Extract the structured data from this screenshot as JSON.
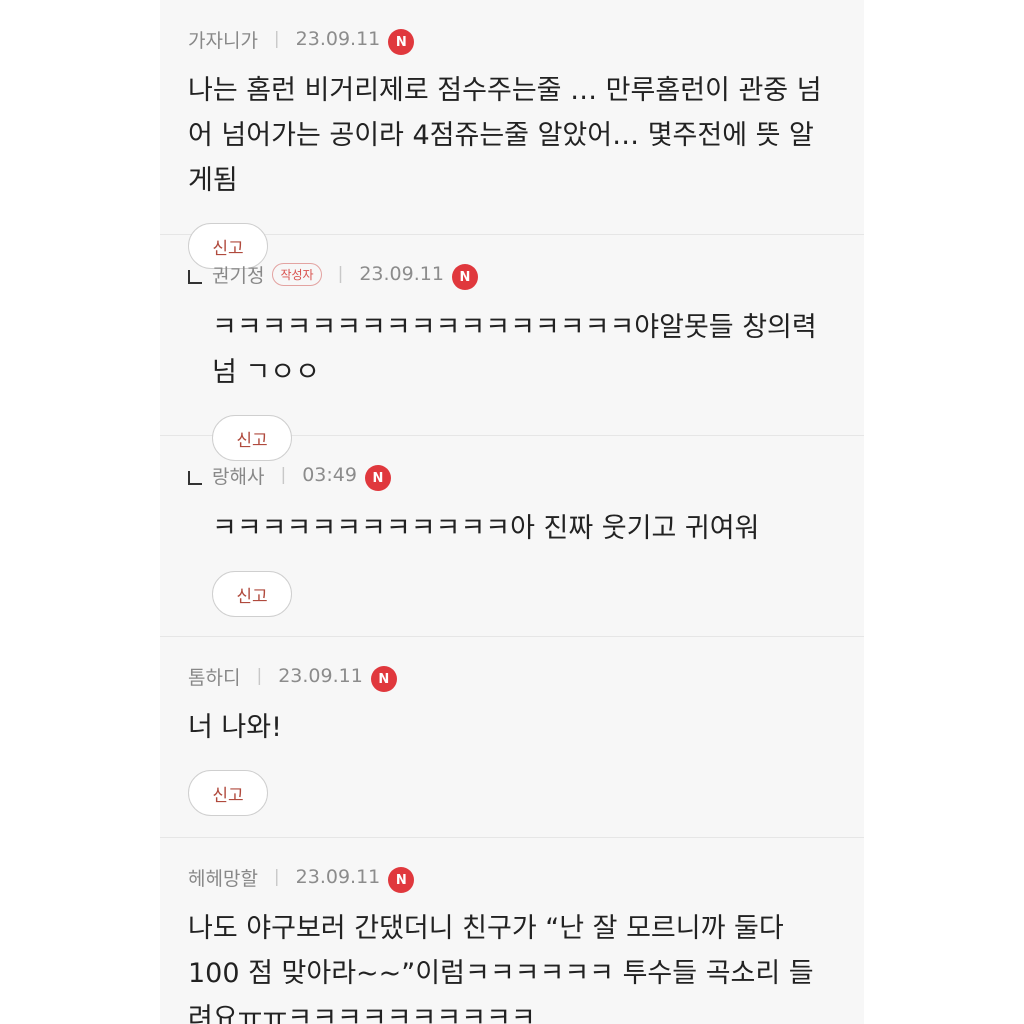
{
  "comments": [
    {
      "author": "가자니가",
      "date": "23.09.11",
      "badge": "N",
      "text": "나는 홈런 비거리제로 점수주는줄 … 만루홈런이 관중 넘어 넘어가는 공이라 4점쥬는줄 알았어… 몇주전에 뜻 알게됨",
      "report": "신고"
    },
    {
      "author": "권기정",
      "author_tag": "작성자",
      "date": "23.09.11",
      "badge": "N",
      "text": "ㅋㅋㅋㅋㅋㅋㅋㅋㅋㅋㅋㅋㅋㅋㅋㅋㅋ야알못들 창의력 넘 ㄱㅇㅇ",
      "report": "신고"
    },
    {
      "author": "랑해사",
      "date": "03:49",
      "badge": "N",
      "text": "ㅋㅋㅋㅋㅋㅋㅋㅋㅋㅋㅋㅋ아 진짜 웃기고 귀여워",
      "report": "신고"
    },
    {
      "author": "톰하디",
      "date": "23.09.11",
      "badge": "N",
      "text": "너 나와!",
      "report": "신고"
    },
    {
      "author": "헤헤망할",
      "date": "23.09.11",
      "badge": "N",
      "text": "나도 야구보러 간댔더니 친구가 “난 잘 모르니까 둘다 100 점 맞아라~~”이럼ㅋㅋㅋㅋㅋㅋ 투수들 곡소리 들려요ㅠㅠㅋㅋㅋㅋㅋㅋㅋㅋㅋㅋ"
    }
  ]
}
